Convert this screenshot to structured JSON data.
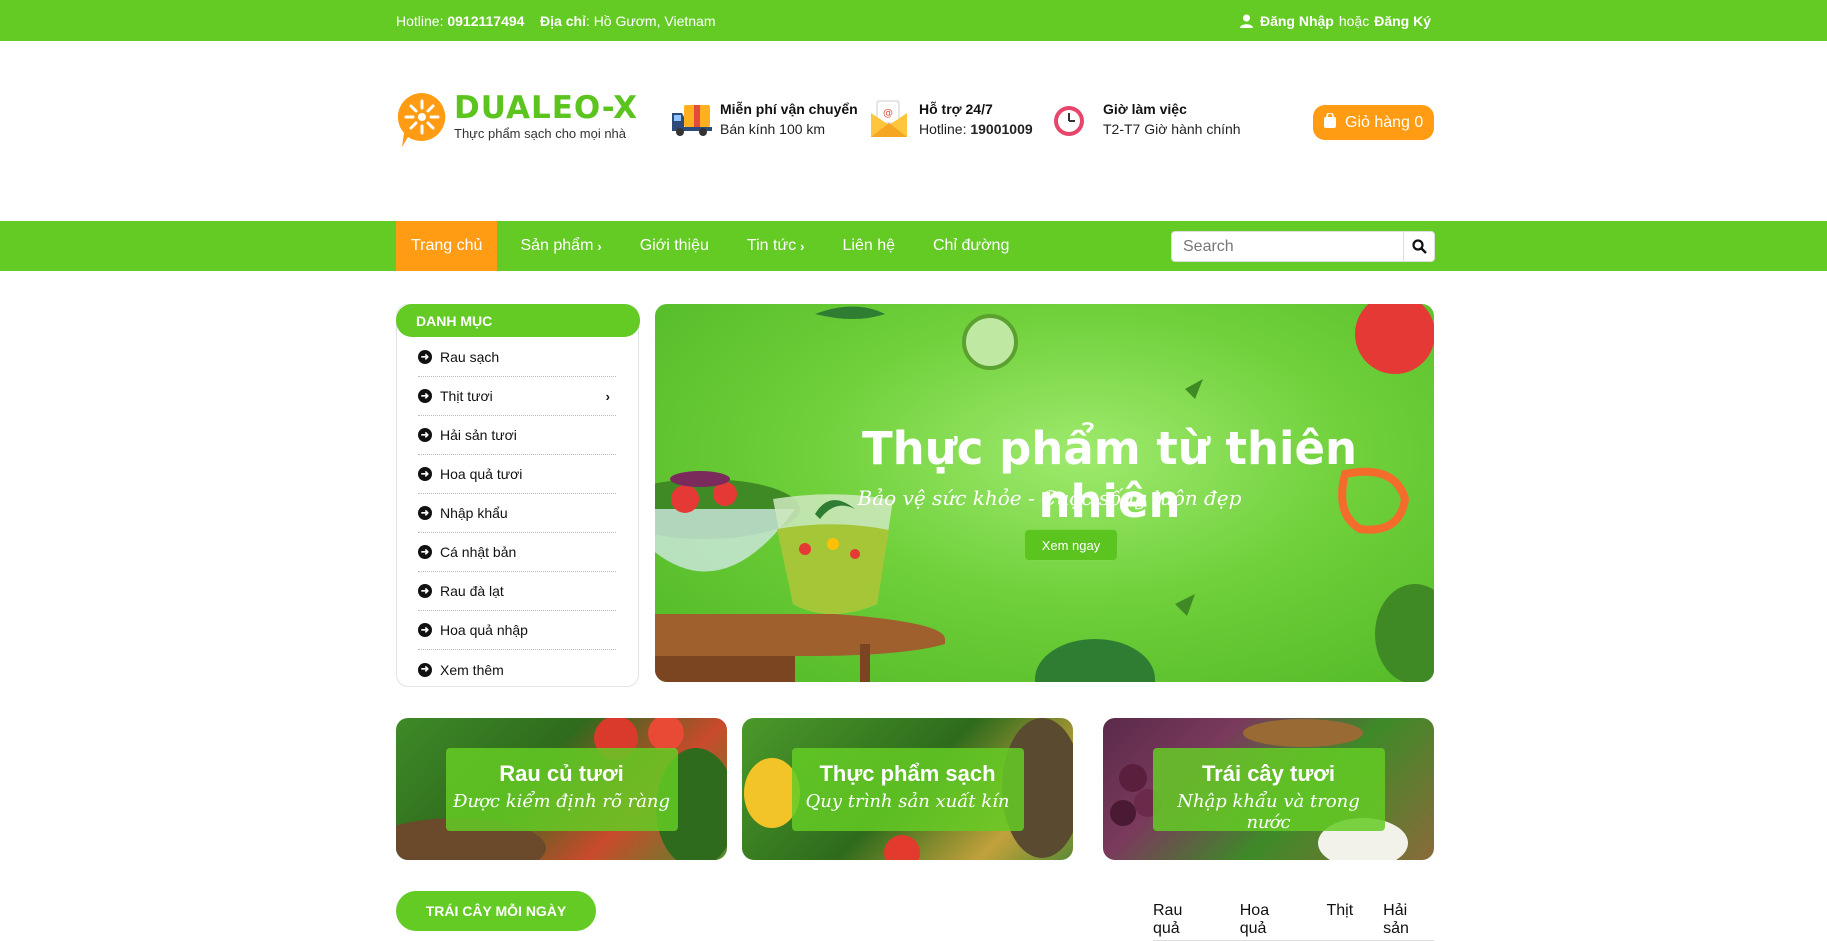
{
  "topbar": {
    "hotline_label": "Hotline:",
    "hotline_number": "0912117494",
    "address_label": "Địa chỉ",
    "address_value": ": Hồ Gươm, Vietnam",
    "login": "Đăng Nhập",
    "or": "hoặc",
    "register": "Đăng Ký"
  },
  "brand": {
    "name": "DUALEO-X",
    "tagline": "Thực phẩm sạch cho mọi nhà",
    "color": "#5cc41f"
  },
  "features": [
    {
      "title": "Miễn phí vận chuyển",
      "text": "Bán kính 100 km",
      "icon": "truck-icon"
    },
    {
      "title": "Hỗ trợ 24/7",
      "text_prefix": "Hotline: ",
      "text_bold": "19001009",
      "icon": "envelope-icon"
    },
    {
      "title": "Giờ làm việc",
      "text": "T2-T7 Giờ hành chính",
      "icon": "clock-icon"
    }
  ],
  "cart": {
    "label": "Giỏ hàng",
    "count": "0"
  },
  "nav": {
    "items": [
      {
        "label": "Trang chủ",
        "active": true
      },
      {
        "label": "Sản phẩm",
        "submenu": true
      },
      {
        "label": "Giới thiệu"
      },
      {
        "label": "Tin tức",
        "submenu": true
      },
      {
        "label": "Liên hệ"
      },
      {
        "label": "Chỉ đường"
      }
    ],
    "chevron": "›"
  },
  "search": {
    "placeholder": "Search"
  },
  "sidebar": {
    "title": "DANH MỤC",
    "items": [
      {
        "label": "Rau sạch"
      },
      {
        "label": "Thịt tươi",
        "submenu": true
      },
      {
        "label": "Hải sản tươi"
      },
      {
        "label": "Hoa quả tươi"
      },
      {
        "label": "Nhập khẩu"
      },
      {
        "label": "Cá nhật bản"
      },
      {
        "label": "Rau đà lạt"
      },
      {
        "label": "Hoa quả nhập"
      },
      {
        "label": "Xem thêm"
      }
    ]
  },
  "banner": {
    "title": "Thực phẩm từ thiên nhiên",
    "subtitle": "Bảo vệ sức khỏe - Cuộc sống luôn đẹp",
    "cta": "Xem ngay"
  },
  "promos": [
    {
      "title": "Rau củ tươi",
      "subtitle": "Được kiểm định rõ ràng"
    },
    {
      "title": "Thực phẩm sạch",
      "subtitle": "Quy trình sản xuất kín"
    },
    {
      "title": "Trái cây tươi",
      "subtitle": "Nhập khẩu và trong nước"
    }
  ],
  "section": {
    "title": "TRÁI CÂY MỖI NGÀY",
    "tabs": [
      "Rau quả",
      "Hoa quả",
      "Thịt",
      "Hải sản"
    ]
  },
  "colors": {
    "primary": "#64cb24",
    "accent": "#ff9c13"
  }
}
